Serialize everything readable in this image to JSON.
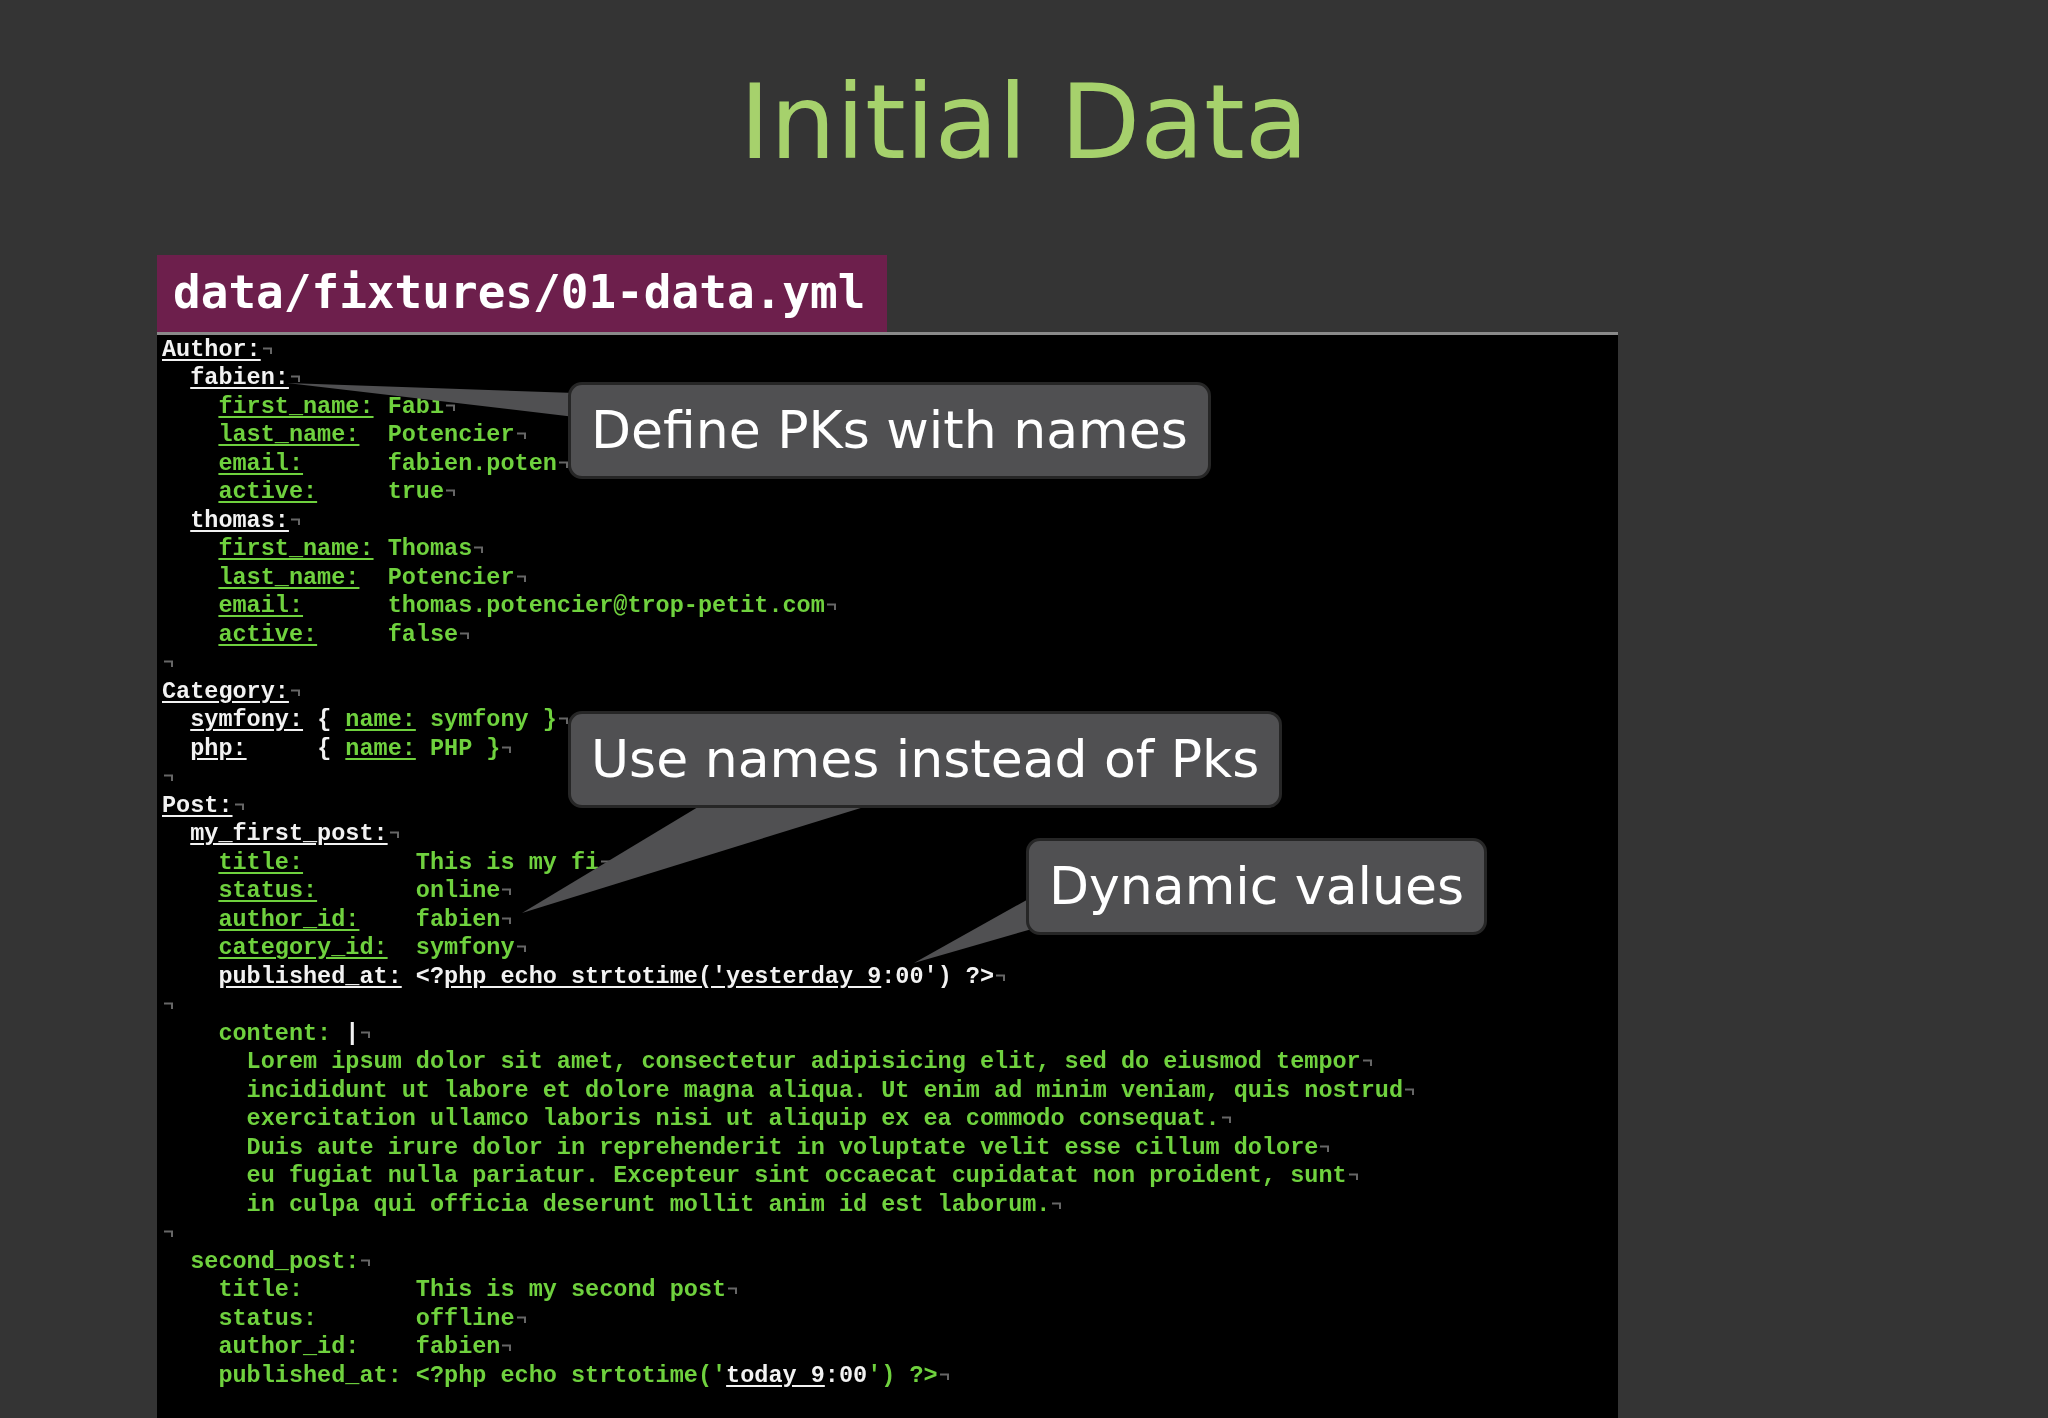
{
  "slide": {
    "title": "Initial Data"
  },
  "file_tab": {
    "label": "data/fixtures/01-data.yml"
  },
  "code": {
    "lines": [
      {
        "kind": "code",
        "key": {
          "text": "Author:",
          "kind": "name"
        },
        "children": [
          {
            "kind": "code",
            "key": {
              "text": "fabien:",
              "kind": "name"
            },
            "children": [
              {
                "kind": "code",
                "key": {
                  "text": "first_name:",
                  "kind": "key"
                },
                "value": [
                  {
                    "text": "Fabi",
                    "kind": "text"
                  }
                ]
              },
              {
                "kind": "code",
                "key": {
                  "text": "last_name:",
                  "kind": "key"
                },
                "value": [
                  {
                    "text": "Potencier",
                    "kind": "text"
                  }
                ]
              },
              {
                "kind": "code",
                "key": {
                  "text": "email:",
                  "kind": "key"
                },
                "value": [
                  {
                    "text": "fabien.poten",
                    "kind": "text"
                  }
                ]
              },
              {
                "kind": "code",
                "key": {
                  "text": "active:",
                  "kind": "key"
                },
                "value": [
                  {
                    "text": "true",
                    "kind": "text"
                  }
                ]
              }
            ]
          },
          {
            "kind": "code",
            "key": {
              "text": "thomas:",
              "kind": "name"
            },
            "children": [
              {
                "kind": "code",
                "key": {
                  "text": "first_name:",
                  "kind": "key"
                },
                "value": [
                  {
                    "text": "Thomas",
                    "kind": "text"
                  }
                ]
              },
              {
                "kind": "code",
                "key": {
                  "text": "last_name:",
                  "kind": "key"
                },
                "value": [
                  {
                    "text": "Potencier",
                    "kind": "text"
                  }
                ]
              },
              {
                "kind": "code",
                "key": {
                  "text": "email:",
                  "kind": "key"
                },
                "value": [
                  {
                    "text": "thomas.potencier@trop-petit.com",
                    "kind": "text"
                  }
                ]
              },
              {
                "kind": "code",
                "key": {
                  "text": "active:",
                  "kind": "key"
                },
                "value": [
                  {
                    "text": "false",
                    "kind": "text"
                  }
                ]
              }
            ]
          }
        ]
      },
      {
        "kind": "blank"
      },
      {
        "kind": "code",
        "key": {
          "text": "Category:",
          "kind": "name"
        },
        "children": [
          {
            "kind": "code",
            "key": {
              "text": "symfony:",
              "kind": "name"
            },
            "value": [
              {
                "text": "{",
                "kind": "punct"
              },
              {
                "text": "name:",
                "kind": "key"
              },
              {
                "text": "symfony }",
                "kind": "text"
              }
            ]
          },
          {
            "kind": "code",
            "key": {
              "text": "php:",
              "kind": "name"
            },
            "value": [
              {
                "text": "{",
                "kind": "punct"
              },
              {
                "text": "name:",
                "kind": "key"
              },
              {
                "text": "PHP }",
                "kind": "text"
              }
            ]
          }
        ]
      },
      {
        "kind": "blank"
      },
      {
        "kind": "code",
        "key": {
          "text": "Post:",
          "kind": "name"
        },
        "children": [
          {
            "kind": "code",
            "key": {
              "text": "my_first_post:",
              "kind": "name"
            },
            "children": [
              {
                "kind": "code",
                "key": {
                  "text": "title:",
                  "kind": "key"
                },
                "value": [
                  {
                    "text": "This is my fi",
                    "kind": "text"
                  }
                ]
              },
              {
                "kind": "code",
                "key": {
                  "text": "status:",
                  "kind": "key"
                },
                "value": [
                  {
                    "text": "online",
                    "kind": "text"
                  }
                ]
              },
              {
                "kind": "code",
                "key": {
                  "text": "author_id:",
                  "kind": "key"
                },
                "value": [
                  {
                    "text": "fabien",
                    "kind": "text"
                  }
                ]
              },
              {
                "kind": "code",
                "key": {
                  "text": "category_id:",
                  "kind": "key"
                },
                "value": [
                  {
                    "text": "symfony",
                    "kind": "text"
                  }
                ]
              },
              {
                "kind": "code",
                "key": {
                  "text": "published_at:",
                  "kind": "name"
                },
                "value": [
                  {
                    "text": "<?",
                    "kind": "punct"
                  },
                  {
                    "text": "php echo strtotime('yesterday 9",
                    "kind": "call",
                    "joined": true
                  },
                  {
                    "text": ":00') ?>",
                    "kind": "punct",
                    "joined": true
                  }
                ]
              },
              {
                "kind": "blank"
              },
              {
                "kind": "code",
                "key": {
                  "text": "content:",
                  "kind": "text"
                },
                "value": [
                  {
                    "text": "|",
                    "kind": "punct"
                  }
                ],
                "children": [
                  {
                    "kind": "code",
                    "key": {
                      "text": "Lorem ipsum dolor sit amet, consectetur adipisicing elit, sed do eiusmod tempor",
                      "kind": "text"
                    }
                  },
                  {
                    "kind": "code",
                    "key": {
                      "text": "incididunt ut labore et dolore magna aliqua. Ut enim ad minim veniam, quis nostrud",
                      "kind": "text"
                    }
                  },
                  {
                    "kind": "code",
                    "key": {
                      "text": "exercitation ullamco laboris nisi ut aliquip ex ea commodo consequat.",
                      "kind": "text"
                    }
                  },
                  {
                    "kind": "code",
                    "key": {
                      "text": "Duis aute irure dolor in reprehenderit in voluptate velit esse cillum dolore",
                      "kind": "text"
                    }
                  },
                  {
                    "kind": "code",
                    "key": {
                      "text": "eu fugiat nulla pariatur. Excepteur sint occaecat cupidatat non proident, sunt",
                      "kind": "text"
                    }
                  },
                  {
                    "kind": "code",
                    "key": {
                      "text": "in culpa qui officia deserunt mollit anim id est laborum.",
                      "kind": "text"
                    }
                  }
                ]
              }
            ]
          },
          {
            "kind": "blank"
          },
          {
            "kind": "code",
            "key": {
              "text": "second_post:",
              "kind": "text"
            },
            "children": [
              {
                "kind": "code",
                "key": {
                  "text": "title:",
                  "kind": "text"
                },
                "value": [
                  {
                    "text": "This is my second post",
                    "kind": "text"
                  }
                ]
              },
              {
                "kind": "code",
                "key": {
                  "text": "status:",
                  "kind": "text"
                },
                "value": [
                  {
                    "text": "offline",
                    "kind": "text"
                  }
                ]
              },
              {
                "kind": "code",
                "key": {
                  "text": "author_id:",
                  "kind": "text"
                },
                "value": [
                  {
                    "text": "fabien",
                    "kind": "text"
                  }
                ]
              },
              {
                "kind": "code",
                "key": {
                  "text": "published_at:",
                  "kind": "text"
                },
                "value": [
                  {
                    "text": "<?php echo strtotime('",
                    "kind": "text"
                  },
                  {
                    "text": "today 9",
                    "kind": "call",
                    "joined": true
                  },
                  {
                    "text": ":00",
                    "kind": "punct",
                    "joined": true
                  },
                  {
                    "text": "') ?>",
                    "kind": "text",
                    "joined": true
                  }
                ]
              }
            ]
          }
        ]
      }
    ]
  },
  "callouts": [
    {
      "text": "Define PKs with names"
    },
    {
      "text": "Use names instead of Pks"
    },
    {
      "text": "Dynamic values"
    }
  ]
}
